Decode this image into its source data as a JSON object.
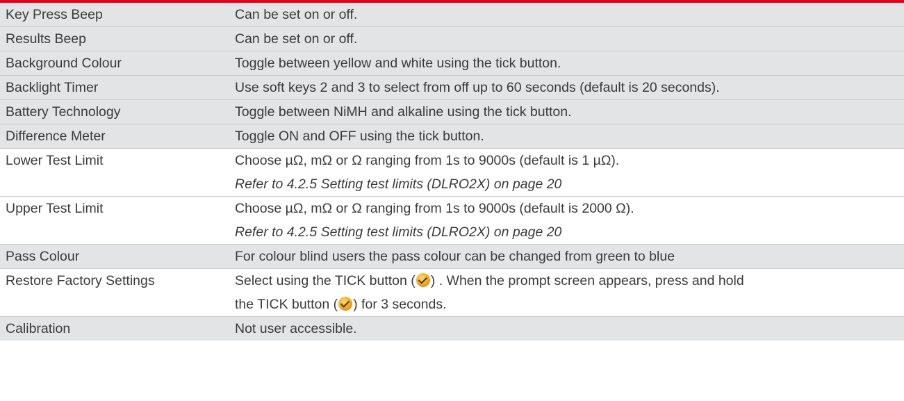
{
  "rows": [
    {
      "name": "Key Press Beep",
      "desc": "Can be set on or off."
    },
    {
      "name": "Results Beep",
      "desc": "Can be set on or off."
    },
    {
      "name": "Background Colour",
      "desc": "Toggle between yellow and white using the tick button."
    },
    {
      "name": "Backlight Timer",
      "desc": "Use soft keys 2 and 3 to select from off up to 60 seconds (default is 20 seconds)."
    },
    {
      "name": "Battery Technology",
      "desc": "Toggle between NiMH and alkaline using the tick button."
    },
    {
      "name": "Difference Meter",
      "desc": "Toggle ON and OFF using the tick button."
    },
    {
      "name": "Lower Test Limit",
      "desc": "Choose µΩ, mΩ or Ω ranging from 1s to 9000s (default is 1 µΩ).",
      "ref": "Refer to 4.2.5 Setting test limits (DLRO2X) on page 20"
    },
    {
      "name": "Upper Test Limit",
      "desc": "Choose µΩ, mΩ or Ω ranging from 1s to 9000s (default is 2000 Ω).",
      "ref": "Refer to 4.2.5 Setting test limits (DLRO2X) on page 20"
    },
    {
      "name": "Pass Colour",
      "desc": "For colour blind users the pass colour can be changed from green to blue"
    },
    {
      "name": "Restore Factory Settings",
      "desc_a": "Select using the TICK button (",
      "desc_b": ") . When the prompt screen appears, press and hold",
      "desc_c": "the TICK button (",
      "desc_d": ") for 3 seconds."
    },
    {
      "name": "Calibration",
      "desc": "Not user accessible."
    }
  ],
  "icons": {
    "tick": "tick-button-icon"
  },
  "colors": {
    "accent_rule": "#e2001a",
    "row_shade": "#e3e4e5",
    "text": "#3a3a3a",
    "tick_icon": "#f1a722"
  }
}
